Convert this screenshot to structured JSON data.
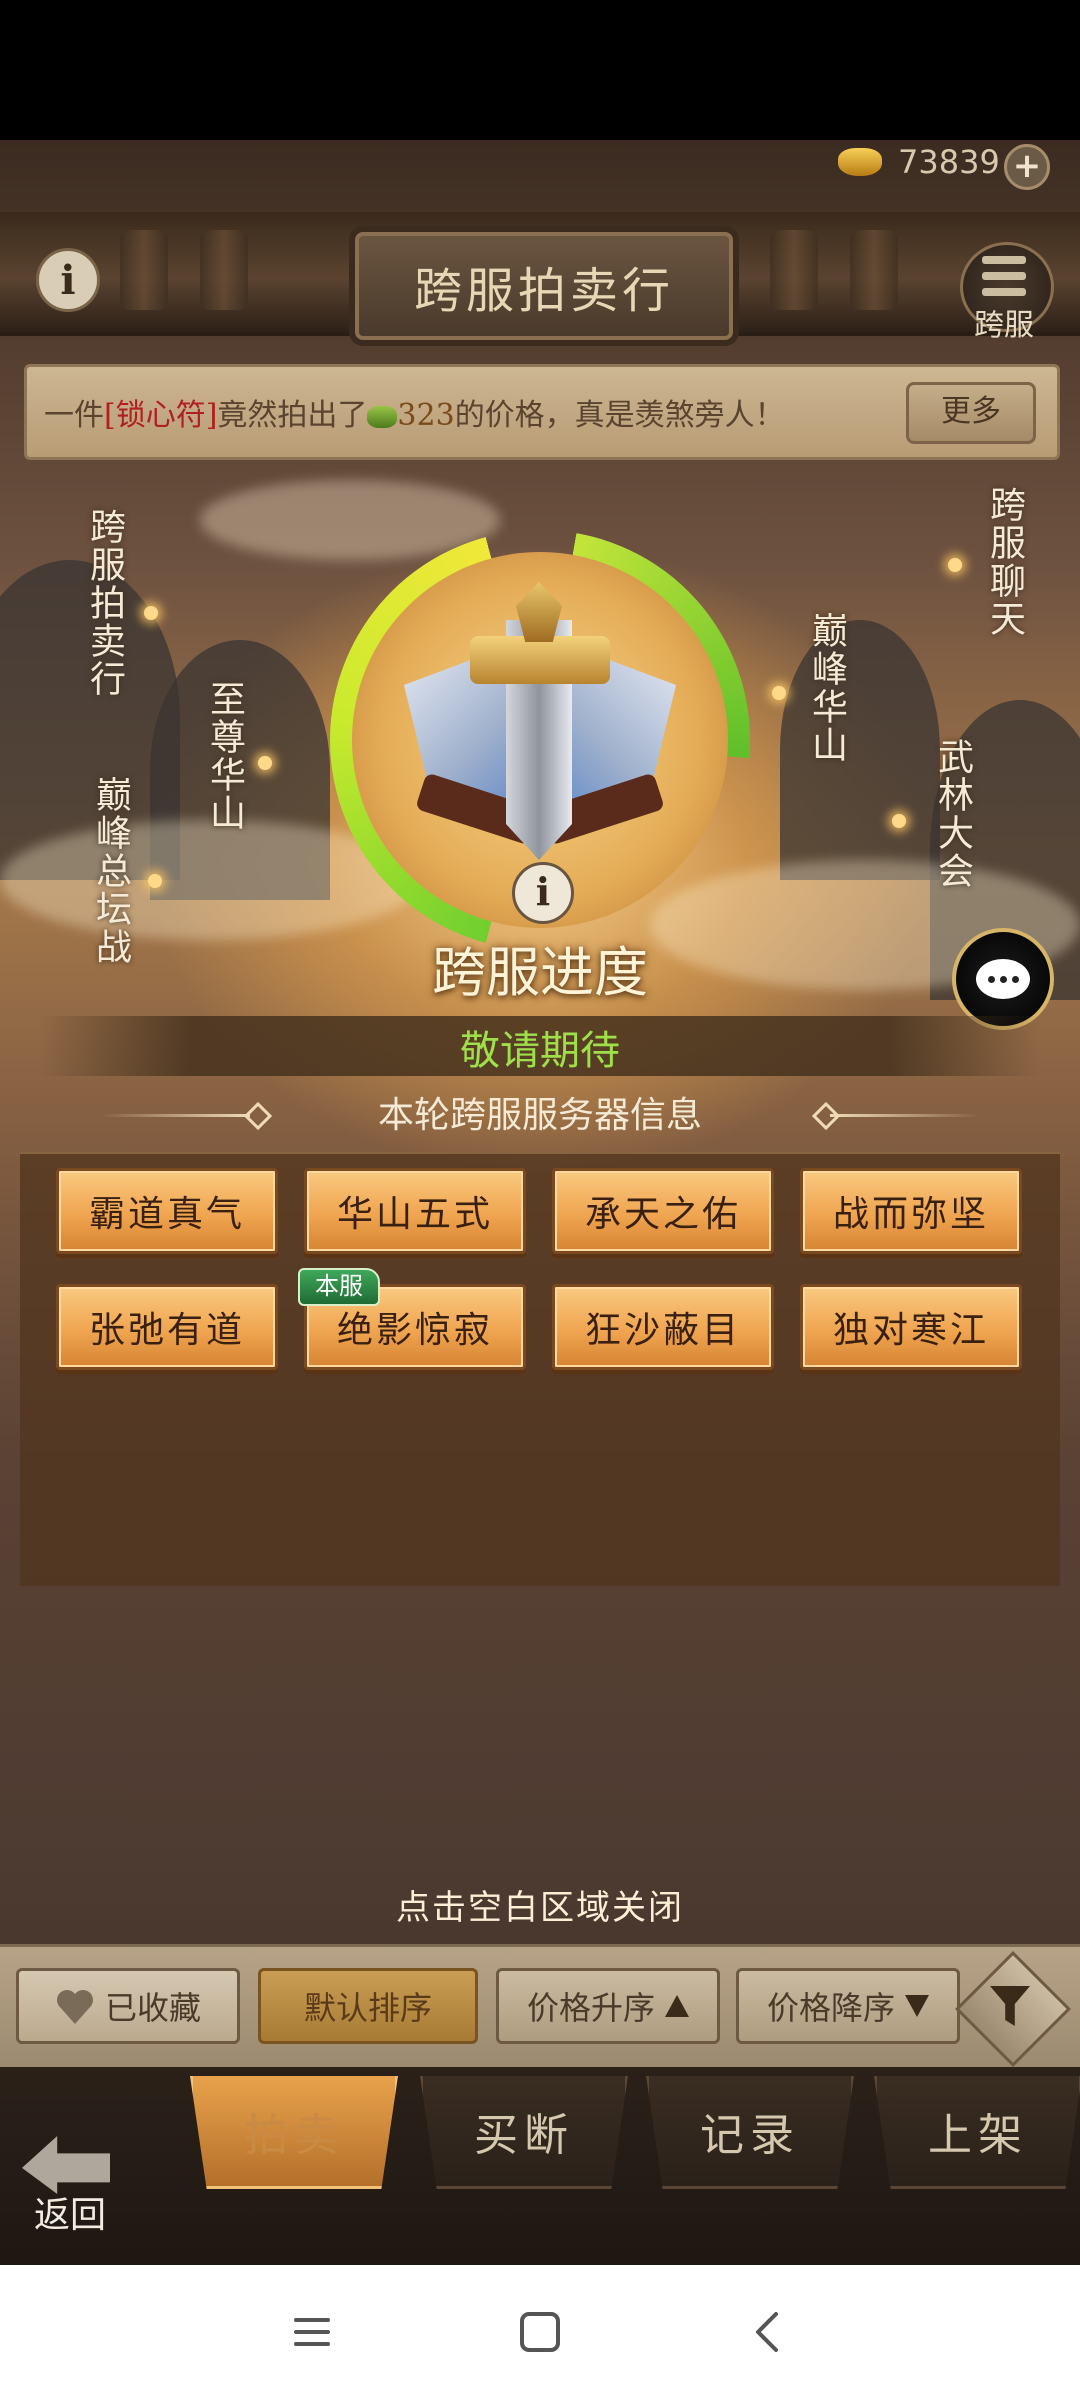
{
  "currency": {
    "icon": "gold-ingot-icon",
    "value": "73839"
  },
  "header": {
    "title": "跨服拍卖行",
    "menu_label": "跨服"
  },
  "ticker": {
    "prefix": "一件",
    "item": "[锁心符]",
    "middle": "竟然拍出了",
    "price": "323",
    "suffix": "的价格，真是羡煞旁人！",
    "more_label": "更多"
  },
  "map_nodes": {
    "left": [
      "跨服拍卖行",
      "至尊华山",
      "巅峰总坛战"
    ],
    "right": [
      "跨服聊天",
      "巅峰华山",
      "武林大会"
    ]
  },
  "emblem": {
    "title": "跨服进度",
    "status": "敬请期待"
  },
  "servers": {
    "header": "本轮跨服服务器信息",
    "current_badge": "本服",
    "list": [
      "霸道真气",
      "华山五式",
      "承天之佑",
      "战而弥坚",
      "张弛有道",
      "绝影惊寂",
      "狂沙蔽目",
      "独对寒江"
    ]
  },
  "close_hint": "点击空白区域关闭",
  "filters": {
    "favorites": "已收藏",
    "default_sort": "默认排序",
    "price_asc": "价格升序",
    "price_desc": "价格降序"
  },
  "tabs": [
    "拍卖",
    "买断",
    "记录",
    "上架"
  ],
  "back_label": "返回",
  "colors": {
    "status_green": "#9fe04a",
    "server_button": "#f0a550",
    "badge_green": "#1f6b34"
  }
}
